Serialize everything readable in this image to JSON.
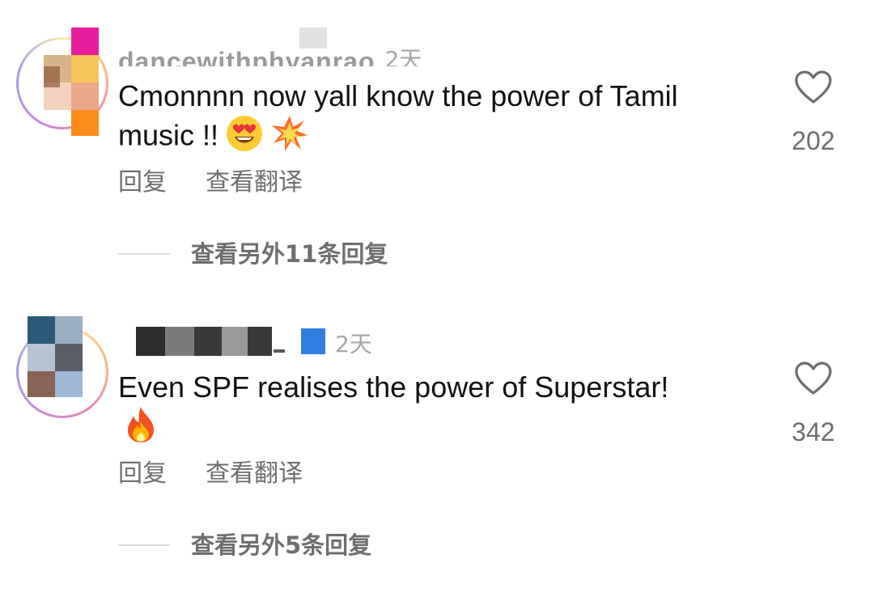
{
  "comments": [
    {
      "username": "dancewithphyanrao",
      "timestamp": "2天",
      "text": "Cmonnnn now yall know the power of Tamil music !!",
      "emojis": [
        "heart-eyes-emoji",
        "collision-emoji"
      ],
      "likes": "202",
      "reply_label": "回复",
      "translate_label": "查看翻译",
      "view_replies_label": "查看另外11条回复"
    },
    {
      "username": "",
      "timestamp": "2天",
      "text": "Even SPF realises the power of Superstar!",
      "emojis": [
        "fire-emoji"
      ],
      "likes": "342",
      "reply_label": "回复",
      "translate_label": "查看翻译",
      "view_replies_label": "查看另外5条回复"
    }
  ],
  "colors": {
    "text": "#111111",
    "secondary": "#6e6e6e",
    "muted": "#9a9a9a"
  }
}
